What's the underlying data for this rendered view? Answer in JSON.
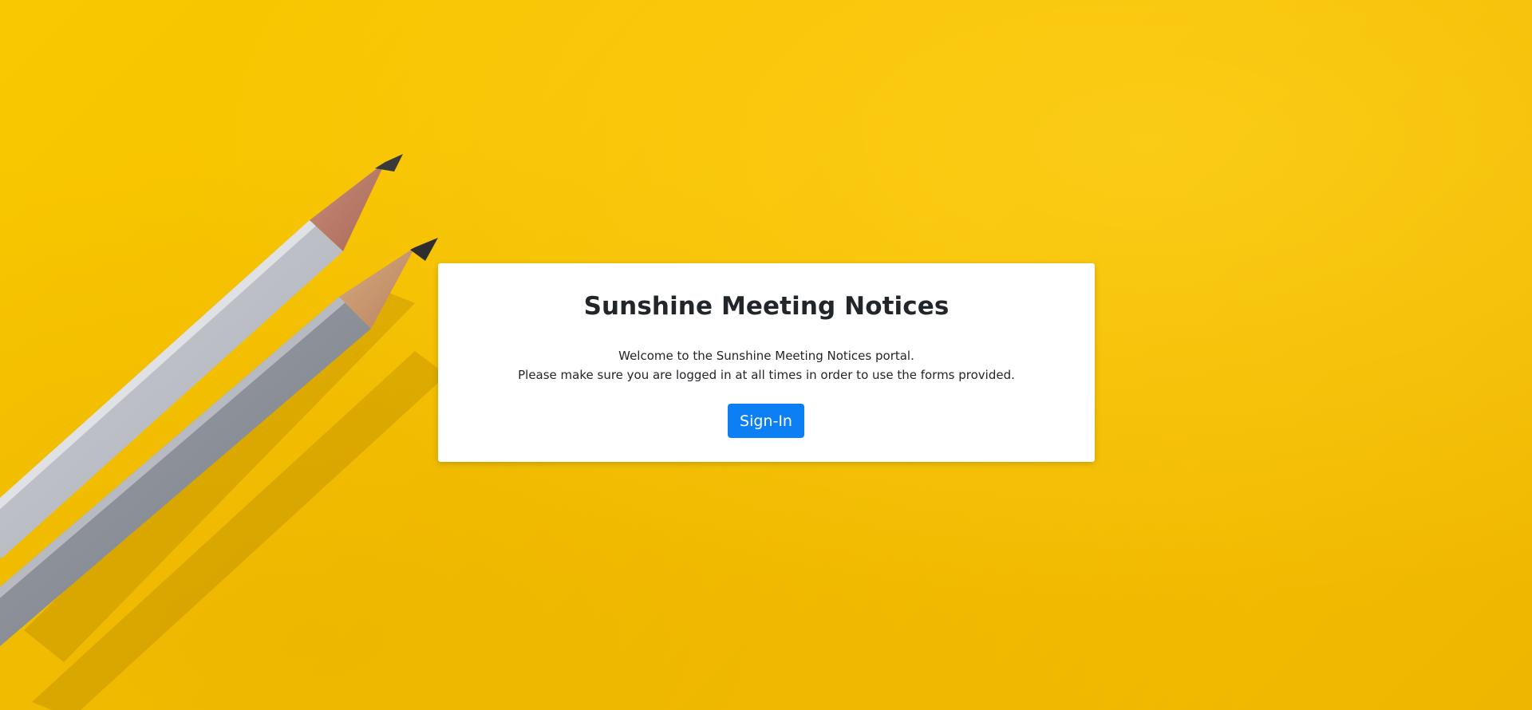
{
  "page": {
    "title": "Sunshine Meeting Notices"
  },
  "card": {
    "title": "Sunshine Meeting Notices",
    "welcome_line": "Welcome to the Sunshine Meeting Notices portal.",
    "instruction_line": "Please make sure you are logged in at all times in order to use the forms provided.",
    "signin_label": "Sign-In"
  },
  "colors": {
    "background": "#f7c300",
    "card": "#ffffff",
    "button": "#0d7ff5",
    "text": "#222529"
  }
}
